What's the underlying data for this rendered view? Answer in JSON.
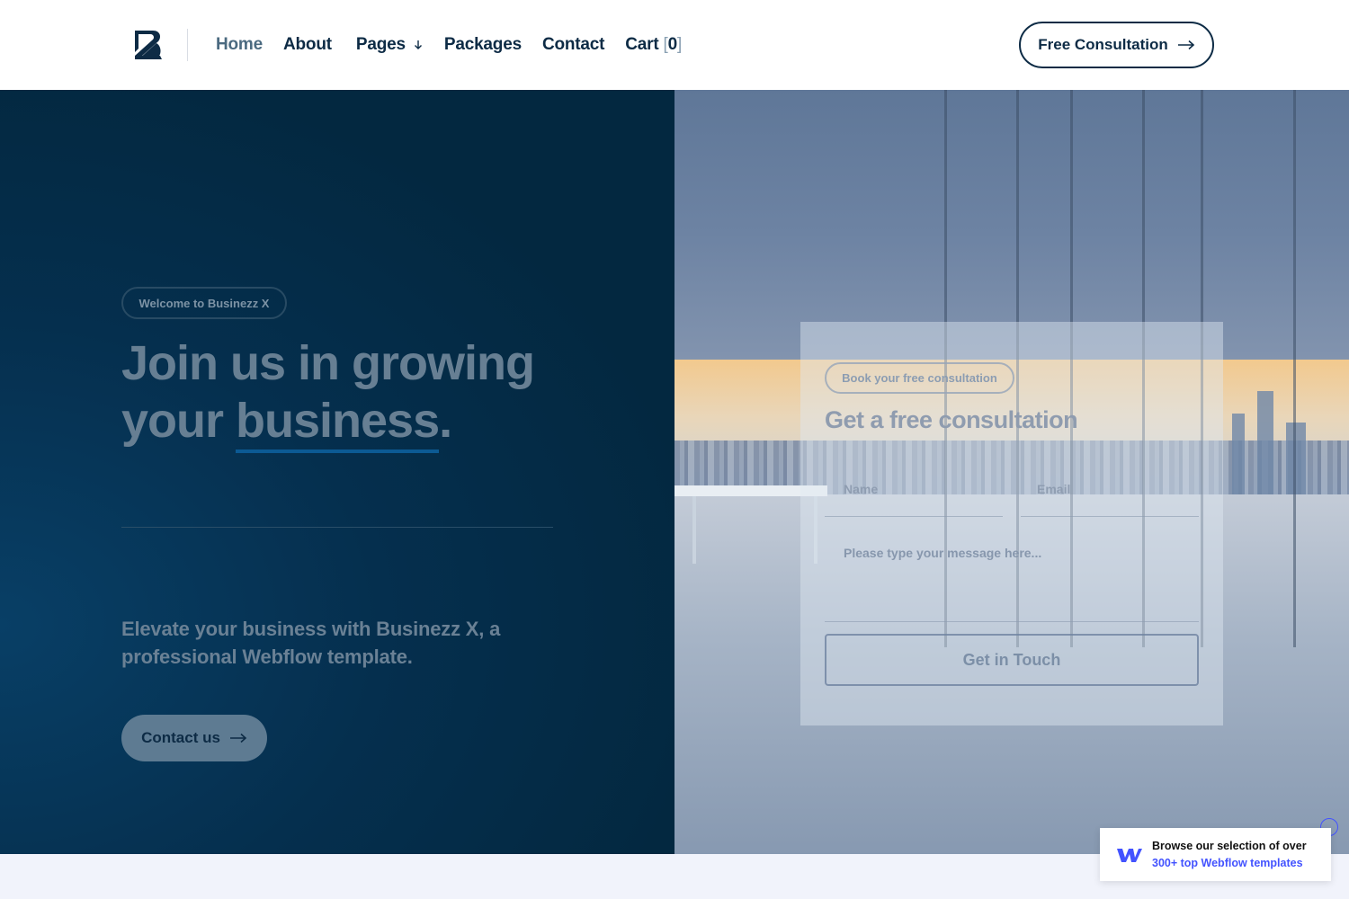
{
  "header": {
    "logo_icon": "businezz-b-logo-icon",
    "nav": [
      {
        "label": "Home",
        "active": true
      },
      {
        "label": "About",
        "active": false
      },
      {
        "label": "Pages",
        "active": false,
        "has_dropdown": true
      },
      {
        "label": "Packages",
        "active": false
      },
      {
        "label": "Contact",
        "active": false
      }
    ],
    "cart": {
      "label": "Cart",
      "open_bracket": "[",
      "count": "0",
      "close_bracket": "]"
    },
    "cta_label": "Free Consultation"
  },
  "hero": {
    "badge": "Welcome to Businezz X",
    "headline_line1": "Join us in growing",
    "headline_line2_prefix": "your ",
    "headline_underlined": "business",
    "headline_suffix": ".",
    "description": "Elevate your business with Businezz X, a professional Webflow template.",
    "contact_button": "Contact us"
  },
  "form": {
    "badge": "Book your free consultation",
    "title": "Get a free consultation",
    "name_label": "Name",
    "email_label": "Email",
    "message_placeholder": "Please type your message here...",
    "submit_label": "Get in Touch"
  },
  "webflow_badge": {
    "line1": "Browse our selection of over",
    "line2": "300+ top Webflow templates"
  },
  "colors": {
    "brand_navy": "#0d2b45",
    "hero_bg": "#032840",
    "accent_underline": "#0c5a94",
    "webflow_blue": "#4353ff"
  }
}
